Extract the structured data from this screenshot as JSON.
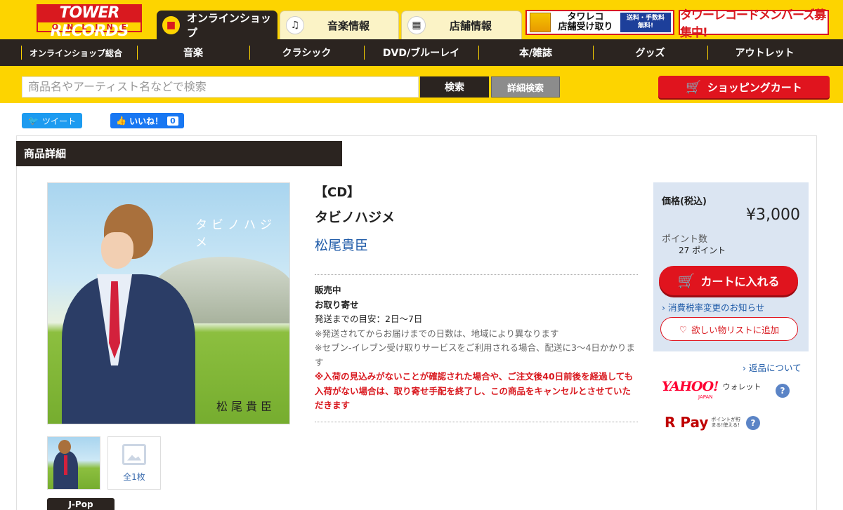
{
  "header": {
    "logo_top": "TOWER RECORDS",
    "logo_bottom": "ONLINE",
    "tabs": [
      {
        "label": "オンラインショップ"
      },
      {
        "label": "音楽情報"
      },
      {
        "label": "店舗情報"
      }
    ],
    "banner_pickup": {
      "title_line1": "タワレコ",
      "title_line2": "店舗受け取り",
      "free_line1": "送料・手数料",
      "free_line2": "無料!"
    },
    "banner_member": "タワーレコードメンバーズ募集中!"
  },
  "nav": {
    "items": [
      "オンラインショップ総合",
      "音楽",
      "クラシック",
      "DVD/ブルーレイ",
      "本/雑誌",
      "グッズ",
      "アウトレット"
    ]
  },
  "search": {
    "placeholder": "商品名やアーティスト名などで検索",
    "search_label": "検索",
    "detail_label": "詳細検索",
    "cart_label": "ショッピングカート"
  },
  "social": {
    "tweet": "ツイート",
    "like": "いいね！",
    "like_count": "0"
  },
  "product": {
    "section_title": "商品詳細",
    "format": "【CD】",
    "title": "タビノハジメ",
    "artist": "松尾貴臣",
    "cover_title": "タビノハジメ",
    "cover_artist": "松尾貴臣",
    "thumbnail_all": "全1枚",
    "genre": "J-Pop",
    "status": "販売中",
    "order_type": "お取り寄せ",
    "shipping_estimate": "発送までの目安：2日〜7日",
    "note1": "※発送されてからお届けまでの日数は、地域により異なります",
    "note2": "※セブン-イレブン受け取りサービスをご利用される場合、配送に3〜4日かかります",
    "warning": "※入荷の見込みがないことが確認された場合や、ご注文後40日前後を経過しても入荷がない場合は、取り寄せ手配を終了し、この商品をキャンセルとさせていただきます"
  },
  "price": {
    "label": "価格(税込)",
    "amount": "¥3,000",
    "points_label": "ポイント数",
    "points": "27 ポイント",
    "add_to_cart": "カートに入れる",
    "tax_notice": "消費税率変更のお知らせ",
    "wishlist": "欲しい物リストに追加",
    "returns": "返品について"
  },
  "payments": {
    "yahoo_logo": "YAHOO!",
    "yahoo_sub": "JAPAN",
    "yahoo_wallet": "ウォレット",
    "rpay_logo": "R Pay",
    "rpay_sub": "ポイントが貯まる!使える!"
  },
  "colors": {
    "brand_yellow": "#fdd400",
    "brand_red": "#d9191f",
    "dark": "#2b2420",
    "link_blue": "#1f5ba8",
    "price_panel": "#dbe5f2"
  }
}
